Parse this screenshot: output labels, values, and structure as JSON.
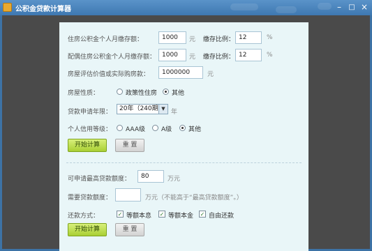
{
  "window": {
    "title": "公积金贷款计算器",
    "minimize": "–",
    "maximize": "□",
    "close": "×"
  },
  "form": {
    "personal_label": "住房公积金个人月缴存额：",
    "personal_value": "1000",
    "unit_yuan": "元",
    "ratio_label": "缴存比例：",
    "personal_ratio": "12",
    "unit_percent": "%",
    "spouse_label": "配偶住房公积金个人月缴存额：",
    "spouse_value": "1000",
    "spouse_ratio": "12",
    "price_label": "房屋评估价值或实际购房款：",
    "price_value": "1000000",
    "house_type_label": "房屋性质：",
    "house_type_options": [
      "政策性住房",
      "其他"
    ],
    "term_label": "贷款申请年限：",
    "term_value": "20年（240期）",
    "term_unit": "年",
    "credit_label": "个人信用等级：",
    "credit_options": [
      "AAA级",
      "A级",
      "其他"
    ],
    "calc_button": "开始计算",
    "reset_button": "重 置"
  },
  "result": {
    "max_amount_label": "可申请最高贷款额度：",
    "max_amount_value": "80",
    "unit_wan": "万元",
    "need_amount_label": "需要贷款额度：",
    "need_amount_value": "",
    "need_amount_hint": "万元（不能高于“最高贷款额度”。）",
    "repay_label": "还款方式：",
    "repay_options": [
      "等额本息",
      "等额本金",
      "自由还款"
    ],
    "calc_button": "开始计算",
    "reset_button": "重 置"
  }
}
